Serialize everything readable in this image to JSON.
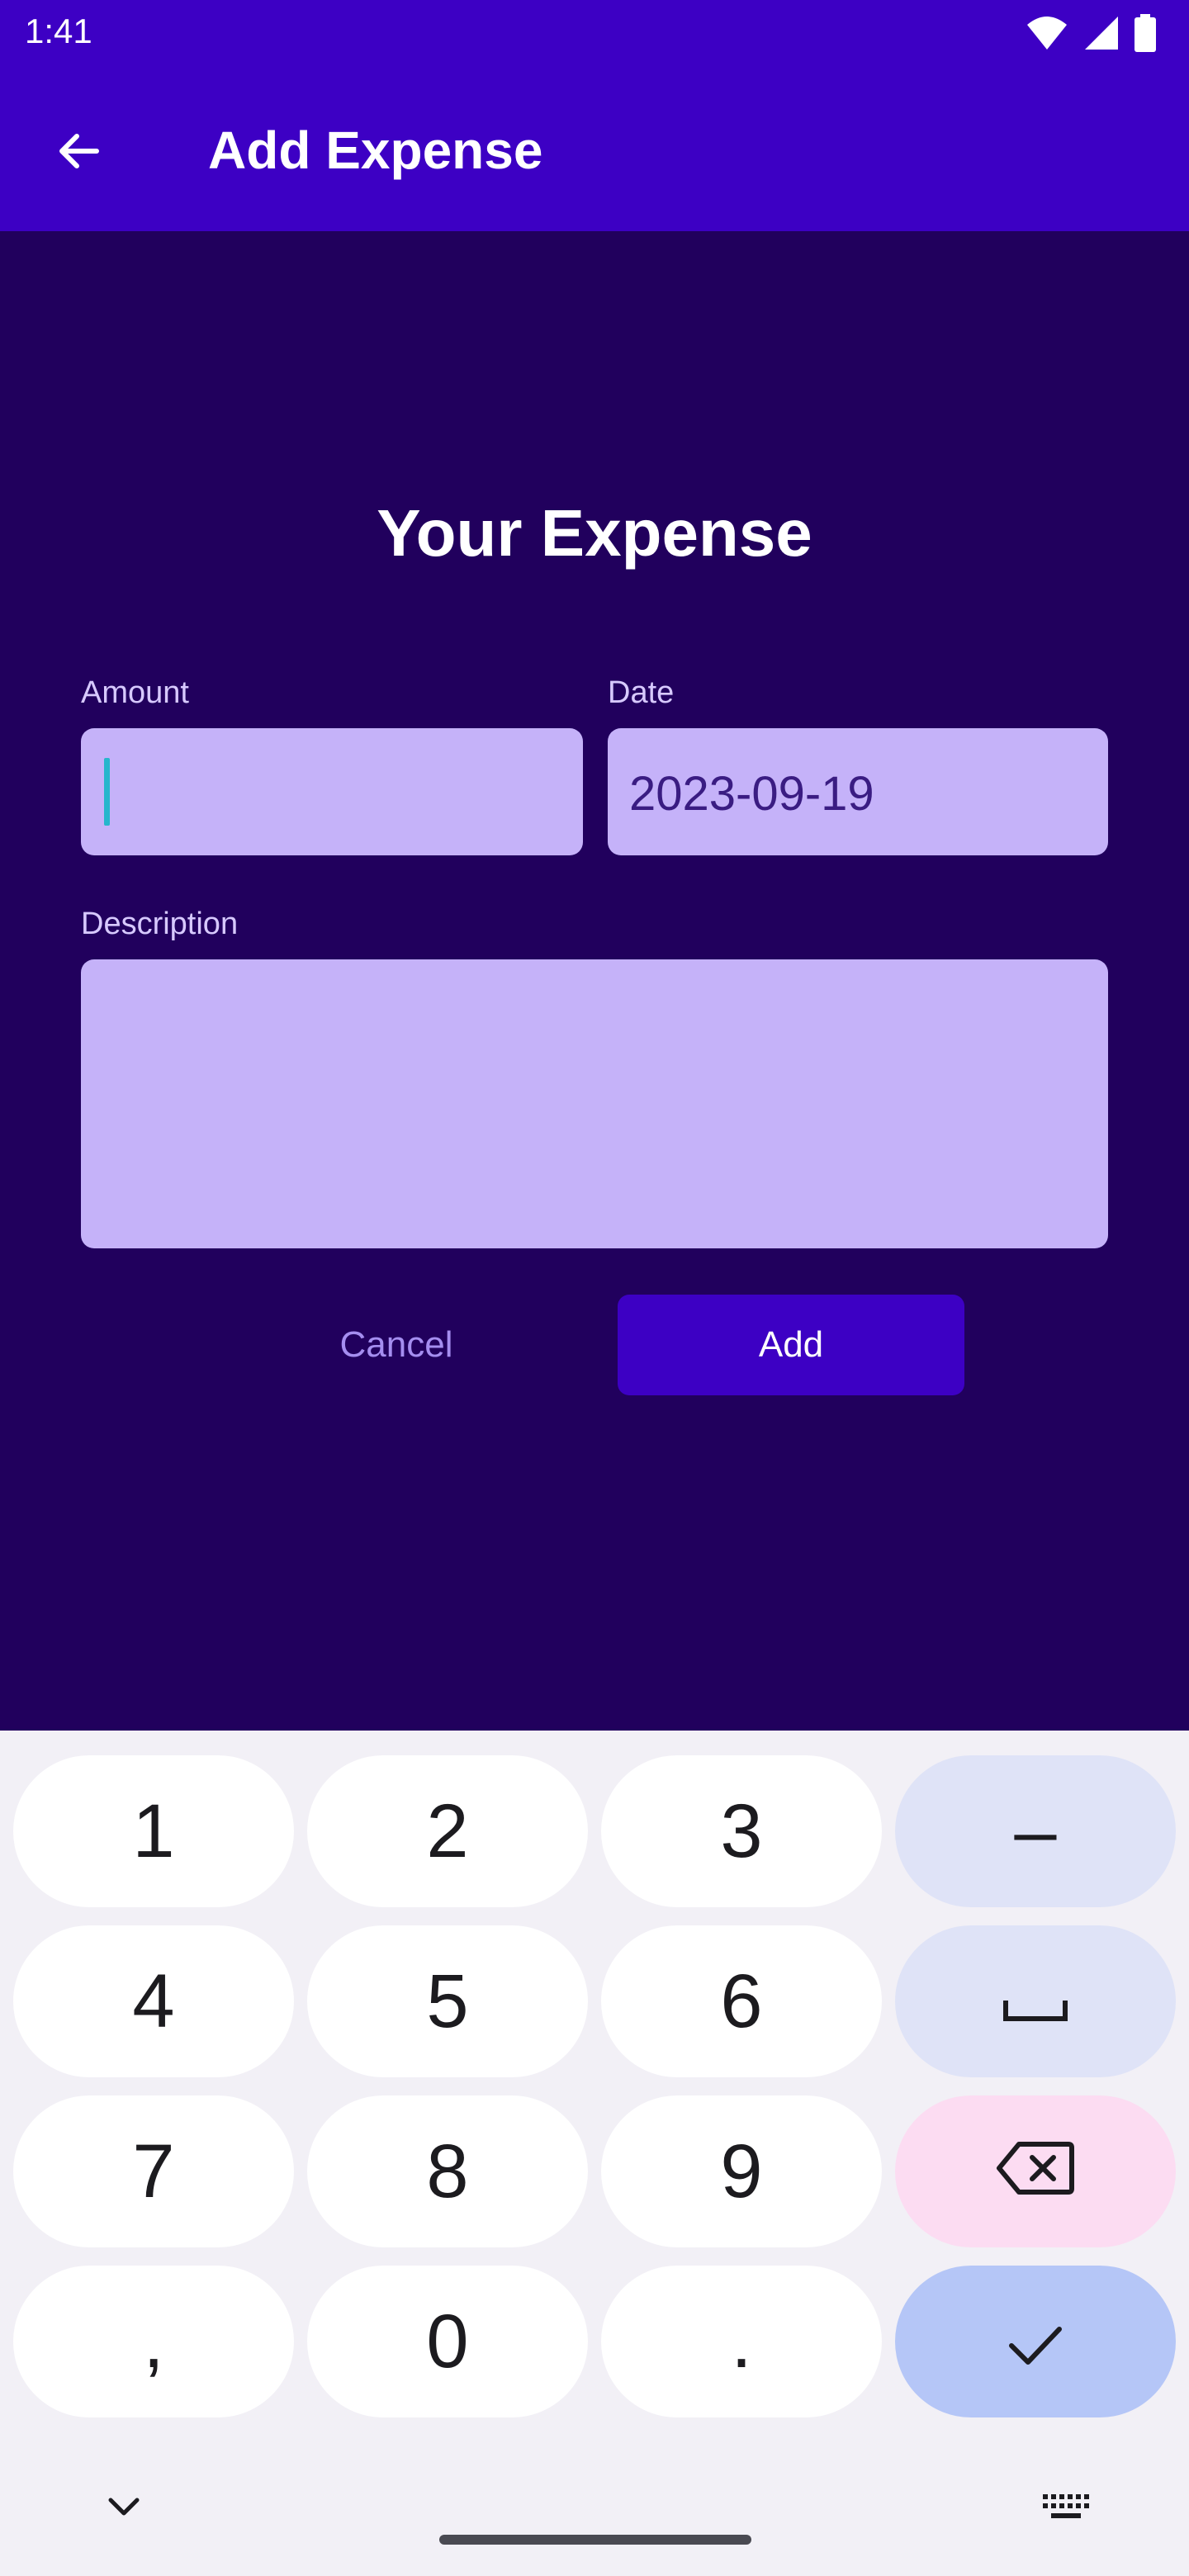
{
  "status_bar": {
    "time": "1:41",
    "icons": [
      "wifi-icon",
      "signal-icon",
      "battery-icon"
    ]
  },
  "app_bar": {
    "title": "Add Expense",
    "back_icon": "arrow-back-icon"
  },
  "form": {
    "heading": "Your Expense",
    "amount": {
      "label": "Amount",
      "value": "",
      "placeholder": ""
    },
    "date": {
      "label": "Date",
      "value": "2023-09-19"
    },
    "description": {
      "label": "Description",
      "value": ""
    },
    "cancel_label": "Cancel",
    "add_label": "Add"
  },
  "keyboard": {
    "rows": [
      [
        "1",
        "2",
        "3",
        "–"
      ],
      [
        "4",
        "5",
        "6",
        "space-icon"
      ],
      [
        "7",
        "8",
        "9",
        "backspace-icon"
      ],
      [
        ",",
        "0",
        ".",
        "check-icon"
      ]
    ],
    "hide_keyboard_icon": "chevron-down-icon",
    "switch_keyboard_icon": "keyboard-icon"
  },
  "colors": {
    "app_bar": "#3d00c4",
    "background": "#21005d",
    "field": "#c5b2f9",
    "accent_cursor": "#27b6cc",
    "keyboard_bg": "#f2f0f6"
  }
}
